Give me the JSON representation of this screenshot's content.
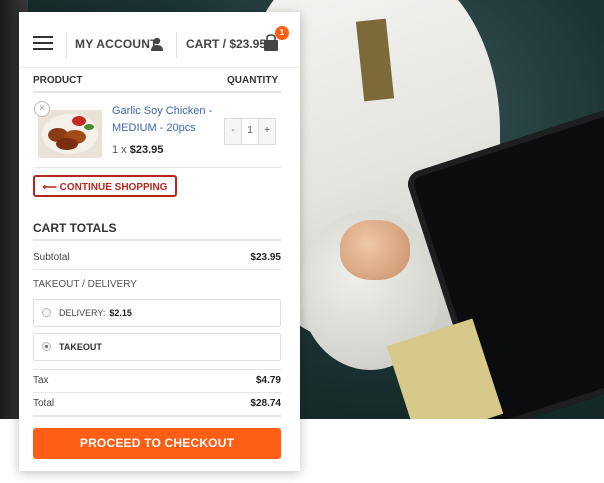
{
  "header": {
    "account_label": "MY ACCOUNT",
    "cart_label": "CART / $23.95",
    "cart_count": "1"
  },
  "table": {
    "col_product": "PRODUCT",
    "col_quantity": "QUANTITY"
  },
  "cart_item": {
    "remove_symbol": "×",
    "name": "Garlic Soy Chicken - MEDIUM - 20pcs",
    "qty_prefix": "1 x",
    "price": "$23.95",
    "qty_minus": "-",
    "qty_value": "1",
    "qty_plus": "+"
  },
  "continue_button": "⟵ CONTINUE SHOPPING",
  "totals": {
    "title": "CART TOTALS",
    "subtotal_label": "Subtotal",
    "subtotal_value": "$23.95",
    "section_label": "TAKEOUT / DELIVERY",
    "delivery_label": "DELIVERY:",
    "delivery_price": "$2.15",
    "takeout_label": "TAKEOUT",
    "tax_label": "Tax",
    "tax_value": "$4.79",
    "total_label": "Total",
    "total_value": "$28.74"
  },
  "checkout_button": "PROCEED TO CHECKOUT",
  "colors": {
    "accent": "#ff5e14",
    "continue": "#b8271f",
    "link": "#3b67b0"
  },
  "icons": [
    "hamburger-icon",
    "user-icon",
    "shopping-bag-icon",
    "remove-icon"
  ]
}
